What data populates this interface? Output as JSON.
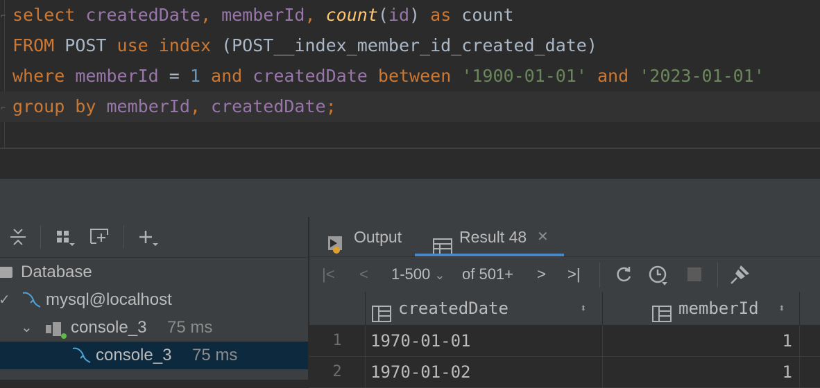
{
  "editor": {
    "lines": [
      {
        "tokens": [
          {
            "t": "select",
            "c": "kw"
          },
          {
            "t": " ",
            "c": "plain"
          },
          {
            "t": "createdDate",
            "c": "col"
          },
          {
            "t": ", ",
            "c": "kw"
          },
          {
            "t": "memberId",
            "c": "col"
          },
          {
            "t": ", ",
            "c": "kw"
          },
          {
            "t": "count",
            "c": "fn"
          },
          {
            "t": "(",
            "c": "plain"
          },
          {
            "t": "id",
            "c": "col"
          },
          {
            "t": ") ",
            "c": "plain"
          },
          {
            "t": "as",
            "c": "kw"
          },
          {
            "t": " count",
            "c": "plain"
          }
        ]
      },
      {
        "tokens": [
          {
            "t": "FROM",
            "c": "kw"
          },
          {
            "t": " POST ",
            "c": "plain"
          },
          {
            "t": "use",
            "c": "kw"
          },
          {
            "t": " ",
            "c": "plain"
          },
          {
            "t": "index",
            "c": "kw"
          },
          {
            "t": " (POST__index_member_id_created_date)",
            "c": "plain"
          }
        ]
      },
      {
        "tokens": [
          {
            "t": "where",
            "c": "kw"
          },
          {
            "t": " ",
            "c": "plain"
          },
          {
            "t": "memberId",
            "c": "col"
          },
          {
            "t": " = ",
            "c": "plain"
          },
          {
            "t": "1",
            "c": "num"
          },
          {
            "t": " ",
            "c": "plain"
          },
          {
            "t": "and",
            "c": "kw"
          },
          {
            "t": " ",
            "c": "plain"
          },
          {
            "t": "createdDate",
            "c": "col"
          },
          {
            "t": " ",
            "c": "plain"
          },
          {
            "t": "between",
            "c": "kw"
          },
          {
            "t": " ",
            "c": "plain"
          },
          {
            "t": "'1900-01-01'",
            "c": "str"
          },
          {
            "t": " ",
            "c": "plain"
          },
          {
            "t": "and",
            "c": "kw"
          },
          {
            "t": " ",
            "c": "plain"
          },
          {
            "t": "'2023-01-01'",
            "c": "str"
          }
        ]
      },
      {
        "tokens": [
          {
            "t": "group by",
            "c": "kw"
          },
          {
            "t": " ",
            "c": "plain"
          },
          {
            "t": "memberId",
            "c": "col"
          },
          {
            "t": ", ",
            "c": "kw"
          },
          {
            "t": "createdDate",
            "c": "col"
          },
          {
            "t": ";",
            "c": "kw"
          }
        ]
      }
    ]
  },
  "db_toolbar": {
    "icons": [
      "collapse-all-icon",
      "group-by-icon",
      "new-query-console-icon",
      "add-icon"
    ]
  },
  "db_tree": {
    "root_label": "Database",
    "datasource_label": "mysql@localhost",
    "console_label": "console_3",
    "console_time": "75 ms",
    "session_label": "console_3",
    "session_time": "75 ms"
  },
  "tabs": {
    "output_label": "Output",
    "result_label": "Result 48",
    "close_symbol": "✕"
  },
  "result_toolbar": {
    "range": "1-500",
    "of_label": "of 501+"
  },
  "grid": {
    "columns": [
      "createdDate",
      "memberId"
    ],
    "rows": [
      {
        "num": "1",
        "createdDate": "1970-01-01",
        "memberId": "1"
      },
      {
        "num": "2",
        "createdDate": "1970-01-02",
        "memberId": "1"
      }
    ]
  },
  "colors": {
    "keyword": "#cc7832",
    "column": "#9876aa",
    "function": "#ffc66d",
    "number": "#6897bb",
    "string": "#6a8759",
    "plain": "#a9b7c6",
    "selection": "#0d293e",
    "active_tab": "#4a88c7"
  }
}
